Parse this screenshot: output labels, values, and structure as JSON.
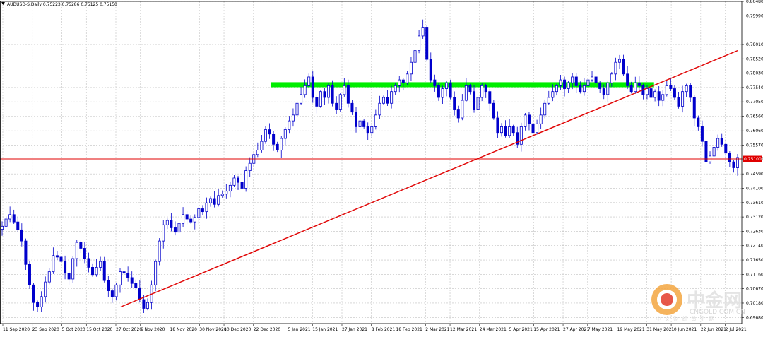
{
  "symbol_info": "AUDUSD-S,Daily  0.75223 0.75286 0.75125 0.75150",
  "current_price_label": "0.75100",
  "watermark": {
    "brand": "中金网",
    "tagline": "中 文 财 经 黄 金 网",
    "url": "CNGOLD.COM.CN"
  },
  "colors": {
    "background": "#ffffff",
    "grid": "#c0c0c0",
    "candle": "#0000cc",
    "trendline": "#e00000",
    "hline": "#e00000",
    "zone": "#00ee00",
    "price_tag_bg": "#e00000"
  },
  "chart_data": {
    "type": "candlestick",
    "title": "AUDUSD-S,Daily",
    "ohlc_last": {
      "open": 0.75223,
      "high": 0.75286,
      "low": 0.75125,
      "close": 0.7515
    },
    "y_axis": {
      "position": "right",
      "range": [
        0.6948,
        0.8048
      ],
      "ticks": [
        "0.80480",
        "0.79990",
        "0.79010",
        "0.78520",
        "0.78030",
        "0.77540",
        "0.77050",
        "0.76560",
        "0.76060",
        "0.75570",
        "0.75100",
        "0.74590",
        "0.74100",
        "0.73610",
        "0.73120",
        "0.72630",
        "0.72140",
        "0.71650",
        "0.71160",
        "0.70670",
        "0.70180",
        "0.69680"
      ]
    },
    "x_axis": {
      "date_range": [
        "2020-09-11",
        "2021-07-07"
      ],
      "ticks": [
        "11 Sep 2020",
        "23 Sep 2020",
        "5 Oct 2020",
        "15 Oct 2020",
        "27 Oct 2020",
        "6 Nov 2020",
        "18 Nov 2020",
        "30 Nov 2020",
        "10 Dec 2020",
        "22 Dec 2020",
        "5 Jan 2021",
        "15 Jan 2021",
        "27 Jan 2021",
        "8 Feb 2021",
        "18 Feb 2021",
        "2 Mar 2021",
        "12 Mar 2021",
        "24 Mar 2021",
        "5 Apr 2021",
        "15 Apr 2021",
        "27 Apr 2021",
        "7 May 2021",
        "19 May 2021",
        "31 May 2021",
        "10 Jun 2021",
        "22 Jun 2021",
        "2 Jul 2021"
      ]
    },
    "grid": true,
    "closes": [
      0.728,
      0.7305,
      0.732,
      0.7295,
      0.7268,
      0.723,
      0.715,
      0.708,
      0.702,
      0.7005,
      0.704,
      0.709,
      0.7125,
      0.718,
      0.7175,
      0.716,
      0.712,
      0.71,
      0.717,
      0.7225,
      0.7205,
      0.717,
      0.714,
      0.7115,
      0.714,
      0.716,
      0.7095,
      0.706,
      0.704,
      0.708,
      0.7125,
      0.712,
      0.7105,
      0.7085,
      0.707,
      0.703,
      0.7,
      0.702,
      0.708,
      0.716,
      0.723,
      0.7285,
      0.73,
      0.7275,
      0.726,
      0.729,
      0.732,
      0.7305,
      0.7295,
      0.731,
      0.734,
      0.733,
      0.736,
      0.7375,
      0.7355,
      0.7385,
      0.739,
      0.74,
      0.742,
      0.7445,
      0.743,
      0.741,
      0.747,
      0.7495,
      0.7525,
      0.754,
      0.757,
      0.761,
      0.7595,
      0.756,
      0.754,
      0.758,
      0.761,
      0.764,
      0.766,
      0.77,
      0.773,
      0.776,
      0.779,
      0.772,
      0.769,
      0.774,
      0.772,
      0.776,
      0.77,
      0.768,
      0.773,
      0.776,
      0.77,
      0.767,
      0.762,
      0.764,
      0.762,
      0.76,
      0.762,
      0.766,
      0.77,
      0.772,
      0.77,
      0.774,
      0.776,
      0.778,
      0.777,
      0.78,
      0.784,
      0.788,
      0.793,
      0.796,
      0.785,
      0.778,
      0.776,
      0.772,
      0.775,
      0.777,
      0.772,
      0.768,
      0.765,
      0.771,
      0.776,
      0.774,
      0.768,
      0.772,
      0.776,
      0.774,
      0.77,
      0.765,
      0.76,
      0.762,
      0.759,
      0.762,
      0.76,
      0.756,
      0.762,
      0.766,
      0.763,
      0.76,
      0.763,
      0.766,
      0.77,
      0.772,
      0.774,
      0.776,
      0.778,
      0.775,
      0.777,
      0.779,
      0.776,
      0.774,
      0.776,
      0.778,
      0.779,
      0.777,
      0.775,
      0.773,
      0.777,
      0.78,
      0.784,
      0.785,
      0.78,
      0.776,
      0.774,
      0.777,
      0.776,
      0.773,
      0.775,
      0.772,
      0.774,
      0.771,
      0.773,
      0.776,
      0.775,
      0.772,
      0.769,
      0.774,
      0.776,
      0.772,
      0.765,
      0.762,
      0.757,
      0.75,
      0.752,
      0.755,
      0.758,
      0.756,
      0.753,
      0.75,
      0.748,
      0.7515
    ],
    "annotations": [
      {
        "type": "trendline",
        "from": [
          "2020-10-29",
          0.7005
        ],
        "to": [
          "2021-07-07",
          0.788
        ]
      },
      {
        "type": "horizontal_line",
        "price": 0.751
      },
      {
        "type": "zone",
        "from": "2020-12-29",
        "to": "2021-06-03",
        "price_range": [
          0.7755,
          0.7772
        ]
      }
    ]
  }
}
